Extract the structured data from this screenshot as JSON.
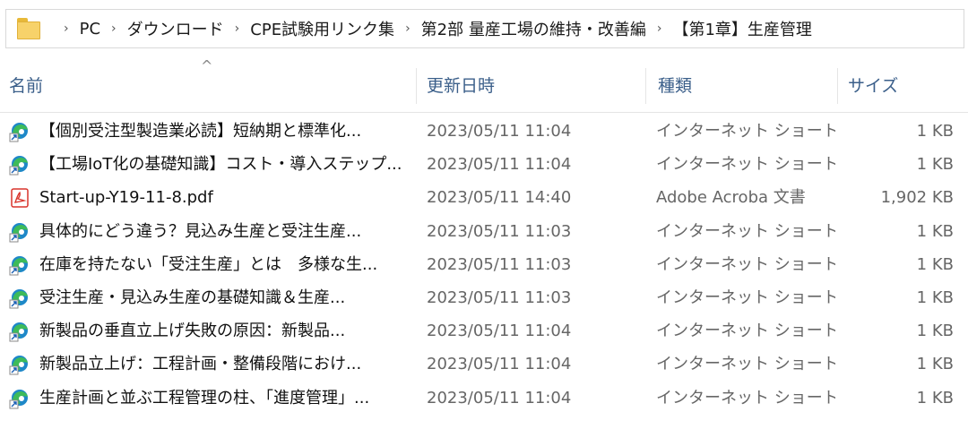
{
  "breadcrumb": {
    "items": [
      "PC",
      "ダウンロード",
      "CPE試験用リンク集",
      "第2部 量産工場の維持・改善編",
      "【第1章】生産管理"
    ],
    "separator": "›"
  },
  "columns": {
    "name": "名前",
    "date": "更新日時",
    "type": "種類",
    "size": "サイズ",
    "sort_indicator": "^"
  },
  "files": [
    {
      "name": "【個別受注型製造業必読】短納期と標準化...",
      "date": "2023/05/11 11:04",
      "type": "インターネット ショート...",
      "size": "1 KB",
      "icon": "internet-shortcut-icon"
    },
    {
      "name": "【工場IoT化の基礎知識】コスト・導入ステップ...",
      "date": "2023/05/11 11:04",
      "type": "インターネット ショート...",
      "size": "1 KB",
      "icon": "internet-shortcut-icon"
    },
    {
      "name": "Start-up-Y19-11-8.pdf",
      "date": "2023/05/11 14:40",
      "type": "Adobe Acroba 文書",
      "size": "1,902 KB",
      "icon": "pdf-icon"
    },
    {
      "name": "具体的にどう違う？見込み生産と受注生産...",
      "date": "2023/05/11 11:03",
      "type": "インターネット ショート...",
      "size": "1 KB",
      "icon": "internet-shortcut-icon"
    },
    {
      "name": "在庫を持たない「受注生産」とは　多様な生...",
      "date": "2023/05/11 11:03",
      "type": "インターネット ショート...",
      "size": "1 KB",
      "icon": "internet-shortcut-icon"
    },
    {
      "name": "受注生産・見込み生産の基礎知識＆生産...",
      "date": "2023/05/11 11:03",
      "type": "インターネット ショート...",
      "size": "1 KB",
      "icon": "internet-shortcut-icon"
    },
    {
      "name": "新製品の垂直立上げ失敗の原因：新製品...",
      "date": "2023/05/11 11:04",
      "type": "インターネット ショート...",
      "size": "1 KB",
      "icon": "internet-shortcut-icon"
    },
    {
      "name": "新製品立上げ：工程計画・整備段階におけ...",
      "date": "2023/05/11 11:04",
      "type": "インターネット ショート...",
      "size": "1 KB",
      "icon": "internet-shortcut-icon"
    },
    {
      "name": "生産計画と並ぶ工程管理の柱、「進度管理」...",
      "date": "2023/05/11 11:04",
      "type": "インターネット ショート...",
      "size": "1 KB",
      "icon": "internet-shortcut-icon"
    }
  ],
  "colors": {
    "header_text": "#3b5f8a",
    "meta_text": "#666666",
    "folder": "#f7d26a",
    "pdf_red": "#d9342b",
    "edge_blue": "#1e88c8",
    "edge_green": "#3dbb5a"
  }
}
